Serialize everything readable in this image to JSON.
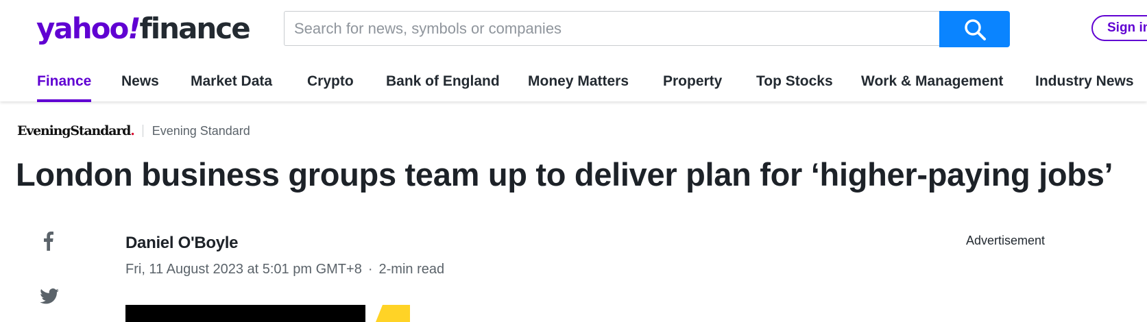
{
  "header": {
    "logo": {
      "part1": "yahoo",
      "part2": "!",
      "part3": "finance"
    },
    "search": {
      "placeholder": "Search for news, symbols or companies"
    },
    "signin_label": "Sign in"
  },
  "nav": {
    "items": [
      {
        "label": "Finance",
        "active": true
      },
      {
        "label": "News"
      },
      {
        "label": "Market Data"
      },
      {
        "label": "Crypto"
      },
      {
        "label": "Bank of England"
      },
      {
        "label": "Money Matters"
      },
      {
        "label": "Property"
      },
      {
        "label": "Top Stocks"
      },
      {
        "label": "Work & Management"
      },
      {
        "label": "Industry News"
      }
    ]
  },
  "article": {
    "source_logo": "EveningStandard",
    "source_logo_dot": ".",
    "source_name": "Evening Standard",
    "headline": "London business groups team up to deliver plan for ‘higher-paying jobs’",
    "author": "Daniel O'Boyle",
    "date": "Fri, 11 August 2023 at 5:01 pm GMT+8",
    "separator": "·",
    "read_time": "2-min read"
  },
  "share": {
    "icons": [
      "facebook-icon",
      "twitter-icon"
    ]
  },
  "ad": {
    "label": "Advertisement"
  },
  "colors": {
    "brand": "#6001d2",
    "search_button": "#0a84ff",
    "text": "#1d2228",
    "muted": "#5b636a",
    "hero_yellow": "#ffd326"
  }
}
